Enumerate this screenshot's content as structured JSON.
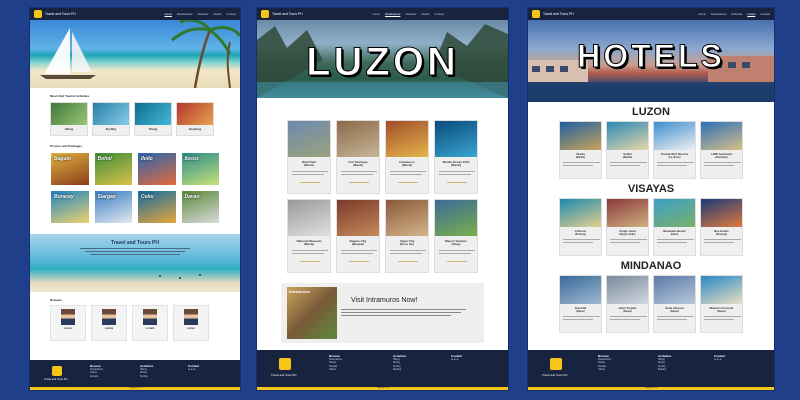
{
  "brand": "Travel and Tours PH",
  "nav": [
    "Home",
    "Destinations",
    "Activities",
    "Hotels",
    "Contact"
  ],
  "home": {
    "activities_title": "Must-Visit Tourist Activities",
    "activities": [
      {
        "name": "Hiking",
        "c1": "#3f7a3a",
        "c2": "#9bc476"
      },
      {
        "name": "Zip-Way",
        "c1": "#2a7fa8",
        "c2": "#86cde8"
      },
      {
        "name": "Diving",
        "c1": "#0e6c8f",
        "c2": "#43b9d9"
      },
      {
        "name": "Kayaking",
        "c1": "#b3372f",
        "c2": "#e8a04c"
      }
    ],
    "promos_title": "Promos and Packages",
    "promos": [
      {
        "name": "Baguio",
        "c1": "#e0b23d",
        "c2": "#8a3d1c"
      },
      {
        "name": "Bohol",
        "c1": "#3f8c3a",
        "c2": "#d9c24a"
      },
      {
        "name": "Iloilo",
        "c1": "#2966b0",
        "c2": "#e36a3a"
      },
      {
        "name": "Ilocos",
        "c1": "#2a8c8a",
        "c2": "#c8e07a"
      },
      {
        "name": "Boracay",
        "c1": "#1d85c6",
        "c2": "#f0d36b"
      },
      {
        "name": "Siargao",
        "c1": "#3a7fc2",
        "c2": "#e2e8ef"
      },
      {
        "name": "Cebu",
        "c1": "#136aa2",
        "c2": "#e7a83c"
      },
      {
        "name": "Davao",
        "c1": "#5a8a3a",
        "c2": "#dadada"
      }
    ],
    "banner_title": "Travel and Tours PH",
    "reviews_title": "Reviews",
    "reviews": [
      "Lorem",
      "Laticia",
      "Loriain",
      "Lamar"
    ]
  },
  "luzon": {
    "hero_title": "LUZON",
    "places": [
      {
        "name": "Rizal Park",
        "sub": "(Manila)",
        "c1": "#6d8ab0",
        "c2": "#9aa27a"
      },
      {
        "name": "Fort Santiago",
        "sub": "(Manila)",
        "c1": "#8a6a4a",
        "c2": "#c7b597"
      },
      {
        "name": "Intramuros",
        "sub": "(Manila)",
        "c1": "#a24d2a",
        "c2": "#e5b64a"
      },
      {
        "name": "Manila Ocean Park",
        "sub": "(Manila)",
        "c1": "#0a4a7a",
        "c2": "#3aa6d2"
      },
      {
        "name": "National Museum",
        "sub": "(Manila)",
        "c1": "#9a9a9a",
        "c2": "#e0e0e0"
      },
      {
        "name": "Baguio City",
        "sub": "(Benguet)",
        "c1": "#7a3a2a",
        "c2": "#c48a5a"
      },
      {
        "name": "Vigan City",
        "sub": "(Ilocos Sur)",
        "c1": "#8a5a3a",
        "c2": "#d4b48a"
      },
      {
        "name": "Mayon Volcano",
        "sub": "(Albay)",
        "c1": "#3a6a9a",
        "c2": "#7ab04a"
      }
    ],
    "feature_title": "Visit Intramuros Now!",
    "feature_img": "Intramuros"
  },
  "hotels": {
    "hero_title": "HOTELS",
    "sections": [
      {
        "region": "LUZON",
        "items": [
          {
            "name": "Okada",
            "sub": "(Manila)",
            "c1": "#1f5fa0",
            "c2": "#c9a45a"
          },
          {
            "name": "Sofitel",
            "sub": "(Manila)",
            "c1": "#2a8ab8",
            "c2": "#e8d6a8"
          },
          {
            "name": "Thunderbird Resorts",
            "sub": "(La Union)",
            "c1": "#3d8fd0",
            "c2": "#f0f0f0"
          },
          {
            "name": "LJMS Sunbeach",
            "sub": "(Zambales)",
            "c1": "#2a70b8",
            "c2": "#d8c08a"
          }
        ]
      },
      {
        "region": "VISAYAS",
        "items": [
          {
            "name": "Crimson",
            "sub": "(Boracay)",
            "c1": "#1b8ab0",
            "c2": "#e6cf8c"
          },
          {
            "name": "Amigo Hotel",
            "sub": "(Region Iloilo)",
            "c1": "#8a3a3a",
            "c2": "#d0b080"
          },
          {
            "name": "Bluewater Beach",
            "sub": "(Cebu)",
            "c1": "#3aa0c8",
            "c2": "#7ab06a"
          },
          {
            "name": "Bee Hotels",
            "sub": "(Boracay)",
            "c1": "#1a3a7a",
            "c2": "#e07a3a"
          }
        ]
      },
      {
        "region": "MINDANAO",
        "items": [
          {
            "name": "Dusit D2",
            "sub": "(Davao)",
            "c1": "#3a6a9a",
            "c2": "#a0b8d0"
          },
          {
            "name": "Hotel Tropika",
            "sub": "(Davao)",
            "c1": "#7a8a9a",
            "c2": "#d0d8e0"
          },
          {
            "name": "Seda Abreeza",
            "sub": "(Davao)",
            "c1": "#5a7aa8",
            "c2": "#b8c8da"
          },
          {
            "name": "Waterfront Insular",
            "sub": "(Davao)",
            "c1": "#2a88c8",
            "c2": "#e8e0c0"
          }
        ]
      }
    ]
  },
  "footer": {
    "brand": "Travel and Tours PH",
    "browse_title": "Browse",
    "browse": [
      "Destinations",
      "Hotels",
      "Rentals",
      "Others"
    ],
    "activities_title": "Activities",
    "activities": [
      "Hiking",
      "Diving",
      "Surfing",
      "Boating"
    ],
    "contact_title": "Contact",
    "social": "⊕ ⊕ ⊕",
    "copyright": "© copyright 2021"
  },
  "colors": {
    "page_bg": "#1f3f8a",
    "footer": "#17233f",
    "accent": "#f5c518"
  }
}
